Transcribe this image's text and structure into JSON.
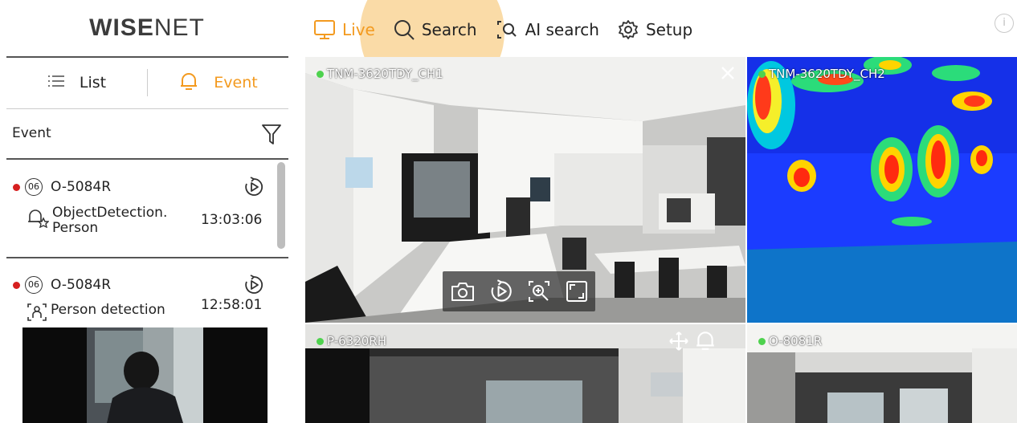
{
  "brand": {
    "logo_text_bold": "WISE",
    "logo_text_thin": "NET"
  },
  "nav": {
    "items": [
      {
        "label": "Live",
        "icon": "monitor-icon",
        "active": true
      },
      {
        "label": "Search",
        "icon": "search-icon",
        "active": false
      },
      {
        "label": "AI search",
        "icon": "ai-search-icon",
        "active": false
      },
      {
        "label": "Setup",
        "icon": "gear-icon",
        "active": false
      }
    ],
    "info": "i"
  },
  "sidebar": {
    "tabs": [
      {
        "label": "List",
        "icon": "list-icon",
        "active": false
      },
      {
        "label": "Event",
        "icon": "bell-icon",
        "active": true
      }
    ],
    "event_header": "Event",
    "events": [
      {
        "badge": "06",
        "camera": "O-5084R",
        "type_line1": "ObjectDetection.",
        "type_line2": "Person",
        "time": "13:03:06"
      },
      {
        "badge": "06",
        "camera": "O-5084R",
        "type_line1": "Person detection",
        "type_line2": "",
        "time": "12:58:01"
      }
    ]
  },
  "cameras": [
    {
      "label": "TNM-3620TDY_CH1"
    },
    {
      "label": "TNM-3620TDY_CH2"
    },
    {
      "label": "P-6320RH"
    },
    {
      "label": "O-8081R"
    }
  ],
  "colors": {
    "accent": "#f39a1f",
    "live_dot": "#4ed24e",
    "event_dot": "#d61f1f"
  }
}
